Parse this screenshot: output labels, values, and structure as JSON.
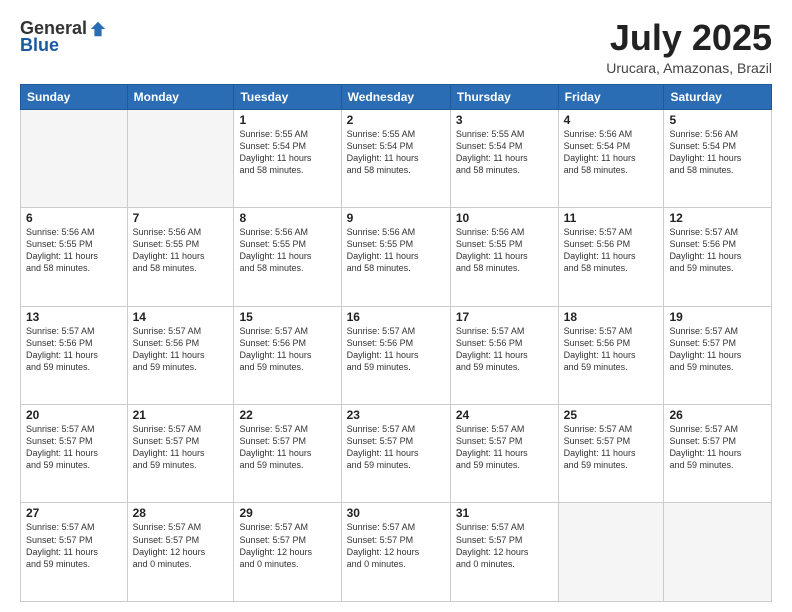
{
  "header": {
    "logo_general": "General",
    "logo_blue": "Blue",
    "title": "July 2025",
    "subtitle": "Urucara, Amazonas, Brazil"
  },
  "weekdays": [
    "Sunday",
    "Monday",
    "Tuesday",
    "Wednesday",
    "Thursday",
    "Friday",
    "Saturday"
  ],
  "weeks": [
    [
      {
        "day": "",
        "info": ""
      },
      {
        "day": "",
        "info": ""
      },
      {
        "day": "1",
        "info": "Sunrise: 5:55 AM\nSunset: 5:54 PM\nDaylight: 11 hours\nand 58 minutes."
      },
      {
        "day": "2",
        "info": "Sunrise: 5:55 AM\nSunset: 5:54 PM\nDaylight: 11 hours\nand 58 minutes."
      },
      {
        "day": "3",
        "info": "Sunrise: 5:55 AM\nSunset: 5:54 PM\nDaylight: 11 hours\nand 58 minutes."
      },
      {
        "day": "4",
        "info": "Sunrise: 5:56 AM\nSunset: 5:54 PM\nDaylight: 11 hours\nand 58 minutes."
      },
      {
        "day": "5",
        "info": "Sunrise: 5:56 AM\nSunset: 5:54 PM\nDaylight: 11 hours\nand 58 minutes."
      }
    ],
    [
      {
        "day": "6",
        "info": "Sunrise: 5:56 AM\nSunset: 5:55 PM\nDaylight: 11 hours\nand 58 minutes."
      },
      {
        "day": "7",
        "info": "Sunrise: 5:56 AM\nSunset: 5:55 PM\nDaylight: 11 hours\nand 58 minutes."
      },
      {
        "day": "8",
        "info": "Sunrise: 5:56 AM\nSunset: 5:55 PM\nDaylight: 11 hours\nand 58 minutes."
      },
      {
        "day": "9",
        "info": "Sunrise: 5:56 AM\nSunset: 5:55 PM\nDaylight: 11 hours\nand 58 minutes."
      },
      {
        "day": "10",
        "info": "Sunrise: 5:56 AM\nSunset: 5:55 PM\nDaylight: 11 hours\nand 58 minutes."
      },
      {
        "day": "11",
        "info": "Sunrise: 5:57 AM\nSunset: 5:56 PM\nDaylight: 11 hours\nand 58 minutes."
      },
      {
        "day": "12",
        "info": "Sunrise: 5:57 AM\nSunset: 5:56 PM\nDaylight: 11 hours\nand 59 minutes."
      }
    ],
    [
      {
        "day": "13",
        "info": "Sunrise: 5:57 AM\nSunset: 5:56 PM\nDaylight: 11 hours\nand 59 minutes."
      },
      {
        "day": "14",
        "info": "Sunrise: 5:57 AM\nSunset: 5:56 PM\nDaylight: 11 hours\nand 59 minutes."
      },
      {
        "day": "15",
        "info": "Sunrise: 5:57 AM\nSunset: 5:56 PM\nDaylight: 11 hours\nand 59 minutes."
      },
      {
        "day": "16",
        "info": "Sunrise: 5:57 AM\nSunset: 5:56 PM\nDaylight: 11 hours\nand 59 minutes."
      },
      {
        "day": "17",
        "info": "Sunrise: 5:57 AM\nSunset: 5:56 PM\nDaylight: 11 hours\nand 59 minutes."
      },
      {
        "day": "18",
        "info": "Sunrise: 5:57 AM\nSunset: 5:56 PM\nDaylight: 11 hours\nand 59 minutes."
      },
      {
        "day": "19",
        "info": "Sunrise: 5:57 AM\nSunset: 5:57 PM\nDaylight: 11 hours\nand 59 minutes."
      }
    ],
    [
      {
        "day": "20",
        "info": "Sunrise: 5:57 AM\nSunset: 5:57 PM\nDaylight: 11 hours\nand 59 minutes."
      },
      {
        "day": "21",
        "info": "Sunrise: 5:57 AM\nSunset: 5:57 PM\nDaylight: 11 hours\nand 59 minutes."
      },
      {
        "day": "22",
        "info": "Sunrise: 5:57 AM\nSunset: 5:57 PM\nDaylight: 11 hours\nand 59 minutes."
      },
      {
        "day": "23",
        "info": "Sunrise: 5:57 AM\nSunset: 5:57 PM\nDaylight: 11 hours\nand 59 minutes."
      },
      {
        "day": "24",
        "info": "Sunrise: 5:57 AM\nSunset: 5:57 PM\nDaylight: 11 hours\nand 59 minutes."
      },
      {
        "day": "25",
        "info": "Sunrise: 5:57 AM\nSunset: 5:57 PM\nDaylight: 11 hours\nand 59 minutes."
      },
      {
        "day": "26",
        "info": "Sunrise: 5:57 AM\nSunset: 5:57 PM\nDaylight: 11 hours\nand 59 minutes."
      }
    ],
    [
      {
        "day": "27",
        "info": "Sunrise: 5:57 AM\nSunset: 5:57 PM\nDaylight: 11 hours\nand 59 minutes."
      },
      {
        "day": "28",
        "info": "Sunrise: 5:57 AM\nSunset: 5:57 PM\nDaylight: 12 hours\nand 0 minutes."
      },
      {
        "day": "29",
        "info": "Sunrise: 5:57 AM\nSunset: 5:57 PM\nDaylight: 12 hours\nand 0 minutes."
      },
      {
        "day": "30",
        "info": "Sunrise: 5:57 AM\nSunset: 5:57 PM\nDaylight: 12 hours\nand 0 minutes."
      },
      {
        "day": "31",
        "info": "Sunrise: 5:57 AM\nSunset: 5:57 PM\nDaylight: 12 hours\nand 0 minutes."
      },
      {
        "day": "",
        "info": ""
      },
      {
        "day": "",
        "info": ""
      }
    ]
  ]
}
